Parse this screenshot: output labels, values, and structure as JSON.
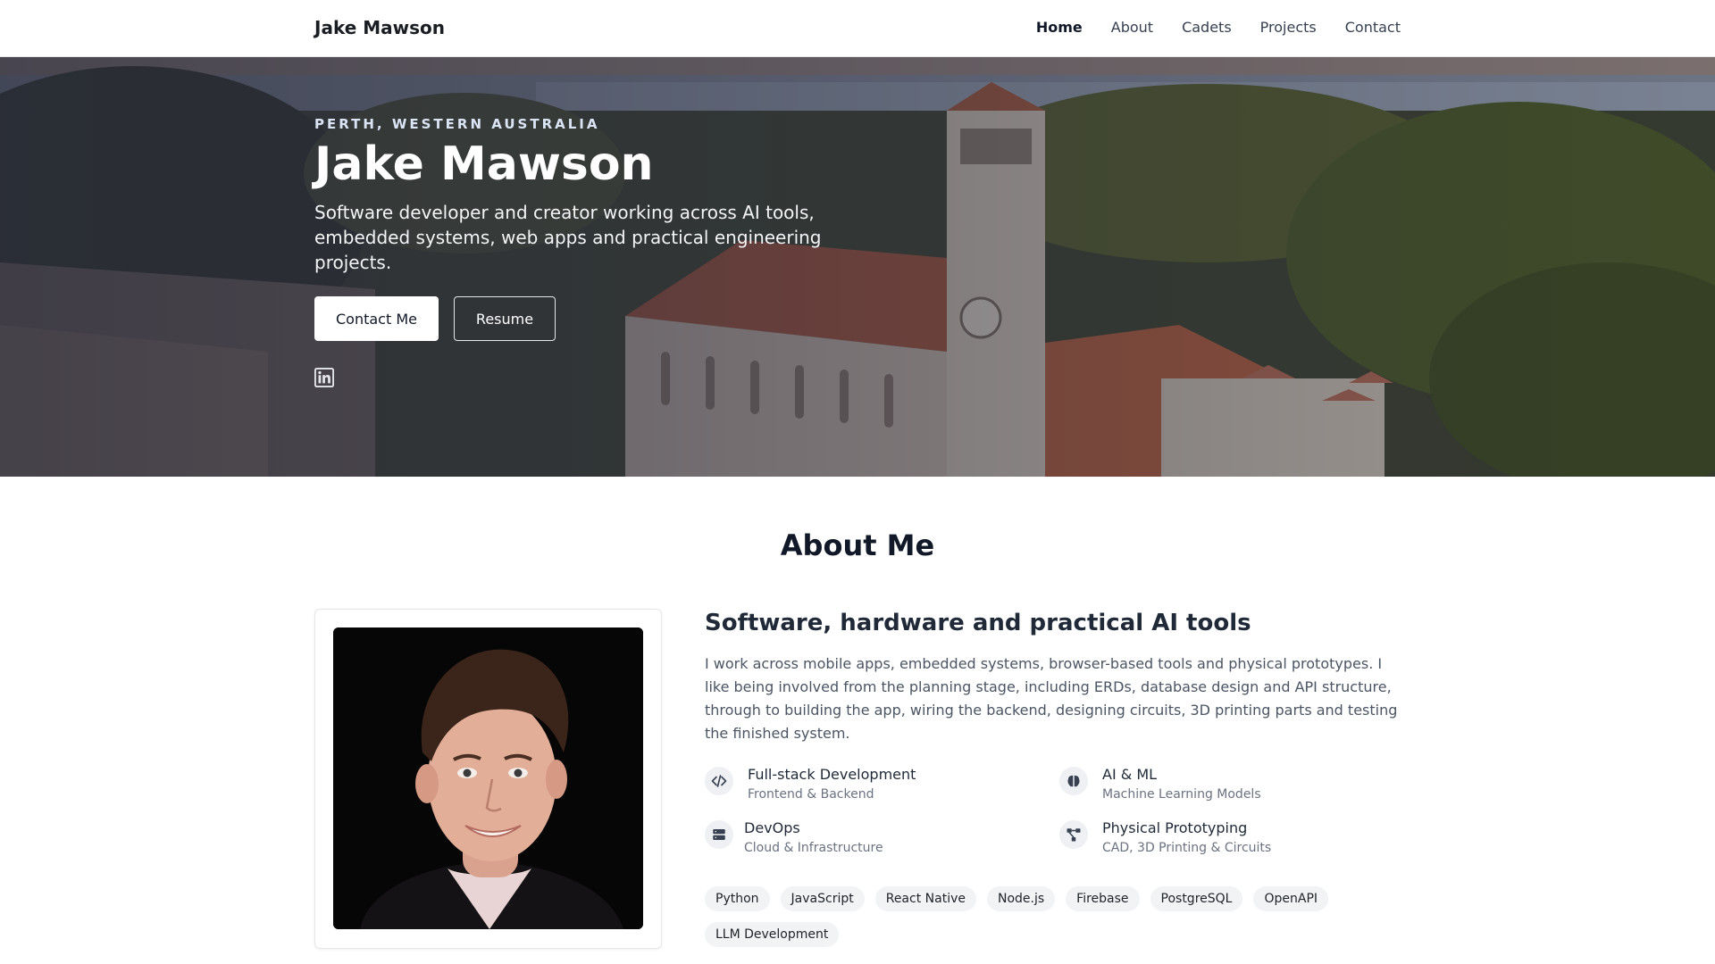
{
  "nav": {
    "brand": "Jake Mawson",
    "links": [
      "Home",
      "About",
      "Cadets",
      "Projects",
      "Contact"
    ],
    "active": "Home"
  },
  "hero": {
    "location": "PERTH, WESTERN AUSTRALIA",
    "name": "Jake Mawson",
    "tagline": "Software developer and creator working across AI tools, embedded systems, web apps and practical engineering projects.",
    "contact_button": "Contact Me",
    "resume_button": "Resume",
    "social_icon": "linkedin-icon"
  },
  "about": {
    "title": "About Me",
    "heading": "Software, hardware and practical AI tools",
    "text": "I work across mobile apps, embedded systems, browser-based tools and physical prototypes. I like being involved from the planning stage, including ERDs, database design and API structure, through to building the app, wiring the backend, designing circuits, 3D printing parts and testing the finished system.",
    "features": [
      {
        "icon": "code-icon",
        "title": "Full-stack Development",
        "subtitle": "Frontend & Backend"
      },
      {
        "icon": "brain-icon",
        "title": "AI & ML",
        "subtitle": "Machine Learning Models"
      },
      {
        "icon": "server-icon",
        "title": "DevOps",
        "subtitle": "Cloud & Infrastructure"
      },
      {
        "icon": "diagram-icon",
        "title": "Physical Prototyping",
        "subtitle": "CAD, 3D Printing & Circuits"
      }
    ],
    "tags": [
      "Python",
      "JavaScript",
      "React Native",
      "Node.js",
      "Firebase",
      "PostgreSQL",
      "OpenAPI",
      "LLM Development"
    ]
  }
}
